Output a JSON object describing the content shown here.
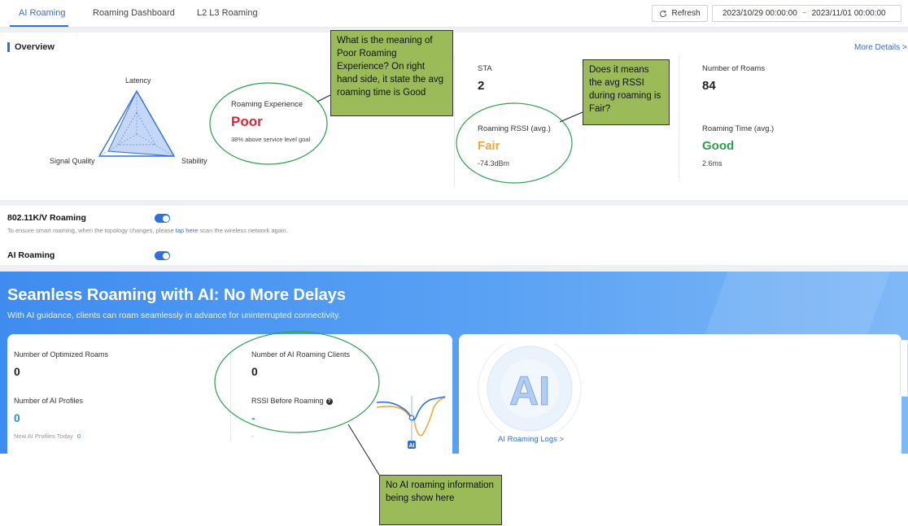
{
  "tabs": [
    "AI Roaming",
    "Roaming Dashboard",
    "L2 L3 Roaming"
  ],
  "toolbar": {
    "refresh_label": "Refresh",
    "date_start": "2023/10/29 00:00:00",
    "date_sep": "~",
    "date_end": "2023/11/01 00:00:00"
  },
  "overview": {
    "title": "Overview",
    "more_details": "More Details >",
    "radar": {
      "latency": "Latency",
      "signal_quality": "Signal Quality",
      "stability": "Stability"
    },
    "roaming_experience": {
      "label": "Roaming Experience",
      "value": "Poor",
      "sub": "38% above service level goal"
    },
    "sta": {
      "label": "STA",
      "value": "2"
    },
    "rssi": {
      "label": "Roaming RSSI (avg.)",
      "value": "Fair",
      "sub": "-74.3dBm"
    },
    "roams": {
      "label": "Number of Roams",
      "value": "84"
    },
    "roaming_time": {
      "label": "Roaming Time (avg.)",
      "value": "Good",
      "sub": "2.6ms"
    }
  },
  "settings": {
    "kv_title": "802.11K/V Roaming",
    "kv_hint_pre": "To ensure smart roaming, when the topology changes, please ",
    "kv_hint_link": "tap here",
    "kv_hint_post": " scan the wireless network again.",
    "ai_title": "AI Roaming"
  },
  "banner": {
    "title": "Seamless Roaming with AI: No More Delays",
    "subtitle": "With AI guidance, clients can roam seamlessly in advance for uninterrupted connectivity.",
    "optimized_roams": {
      "label": "Number of Optimized Roams",
      "value": "0"
    },
    "ai_profiles": {
      "label": "Number of AI Profiles",
      "value": "0",
      "today_label": "New AI Profiles Today",
      "today_value": "0"
    },
    "ai_clients": {
      "label": "Number of AI Roaming Clients",
      "value": "0"
    },
    "rssi_before": {
      "label": "RSSI Before Roaming",
      "value": "-",
      "sub": "-"
    },
    "graph_badge": "AI",
    "ai_logo": "AI",
    "ai_logs": "AI Roaming Logs >"
  },
  "annotations": {
    "note1": "What is the meaning of Poor Roaming Experience? On right hand side, it state the avg roaming time is Good",
    "note2": "Does it means the avg RSSI during roaming is Fair?",
    "note3": "No AI roaming information being show here"
  },
  "colors": {
    "primary": "#2f6fe0",
    "poor": "#d8283a",
    "fair": "#f0a83a",
    "good": "#2aa24b",
    "callout": "#9bbb59",
    "ellipse": "#2aa24b"
  },
  "icons": {
    "refresh": "refresh-icon",
    "help": "help-icon"
  }
}
